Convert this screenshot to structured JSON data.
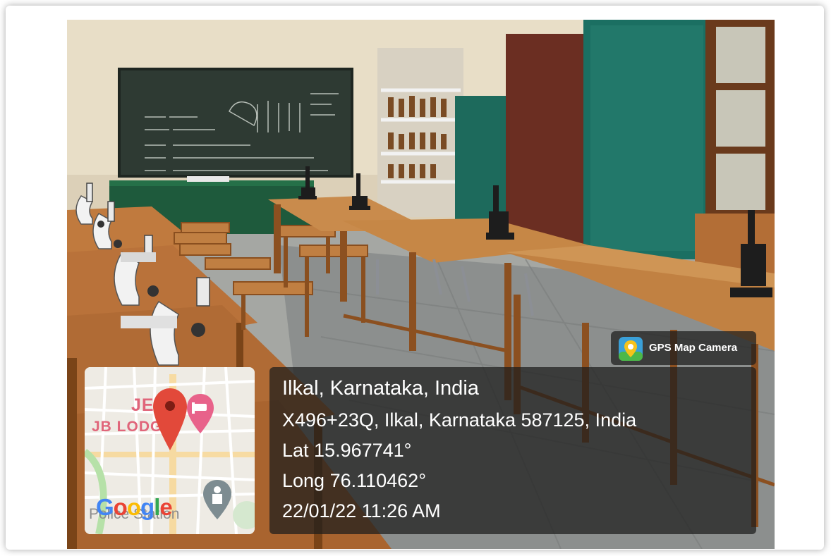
{
  "map_thumbnail": {
    "labels": {
      "place": "JE",
      "lodge": "JB LODG",
      "police": "Police Station"
    },
    "logo_text": "Google",
    "logo_letters": [
      {
        "ch": "G",
        "color": "#4285F4"
      },
      {
        "ch": "o",
        "color": "#EA4335"
      },
      {
        "ch": "o",
        "color": "#FBBC05"
      },
      {
        "ch": "g",
        "color": "#4285F4"
      },
      {
        "ch": "l",
        "color": "#34A853"
      },
      {
        "ch": "e",
        "color": "#EA4335"
      }
    ],
    "icons": [
      "location-pin-icon",
      "hotel-icon",
      "police-station-icon"
    ]
  },
  "location": {
    "place": "Ilkal, Karnataka, India",
    "address": "X496+23Q, Ilkal, Karnataka 587125, India",
    "latitude": "Lat 15.967741°",
    "longitude": "Long 76.110462°",
    "datetime": "22/01/22 11:26 AM"
  },
  "watermark": {
    "app_name": "GPS Map Camera",
    "icon": "gps-map-camera-icon"
  },
  "colors": {
    "pin_red": "#e2493a",
    "hotel_pink": "#e8628a",
    "panel_bg": "#1c1c1c"
  }
}
